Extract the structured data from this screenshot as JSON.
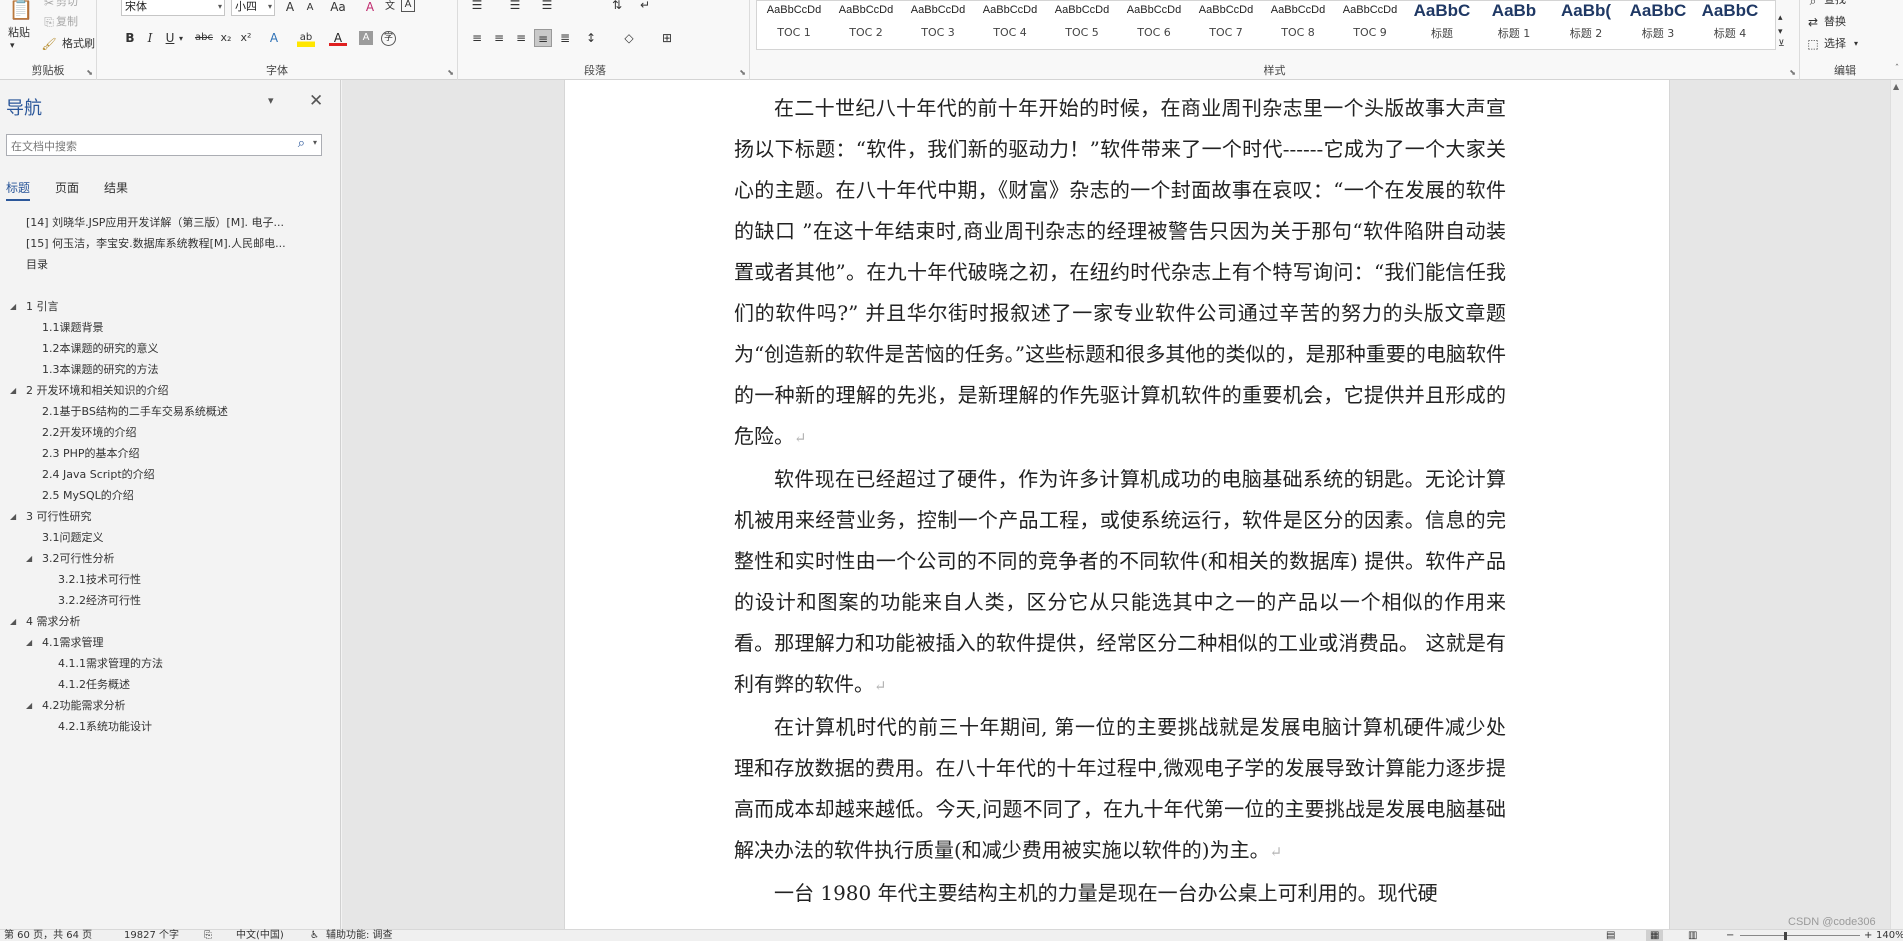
{
  "ribbon": {
    "clipboard": {
      "group_label": "剪贴板",
      "paste_label": "粘贴",
      "cut_label": "剪切",
      "copy_label": "复制",
      "format_painter_label": "格式刷"
    },
    "font": {
      "group_label": "字体",
      "font_name": "宋体",
      "font_size": "小四",
      "grow_icon": "A",
      "shrink_icon": "A",
      "change_case_icon": "Aa",
      "clear_format_icon": "A",
      "phonetic_icon": "文",
      "char_border_icon": "A",
      "bold": "B",
      "italic": "I",
      "underline": "U",
      "strike": "abc",
      "subscript": "x₂",
      "superscript": "x²",
      "text_effect": "A",
      "highlight": "ab",
      "font_color": "A",
      "char_shading": "A",
      "enclose": "字"
    },
    "paragraph": {
      "group_label": "段落"
    },
    "styles": {
      "group_label": "样式",
      "items": [
        {
          "preview": "AaBbCcDd",
          "name": "TOC 1"
        },
        {
          "preview": "AaBbCcDd",
          "name": "TOC 2"
        },
        {
          "preview": "AaBbCcDd",
          "name": "TOC 3"
        },
        {
          "preview": "AaBbCcDd",
          "name": "TOC 4"
        },
        {
          "preview": "AaBbCcDd",
          "name": "TOC 5"
        },
        {
          "preview": "AaBbCcDd",
          "name": "TOC 6"
        },
        {
          "preview": "AaBbCcDd",
          "name": "TOC 7"
        },
        {
          "preview": "AaBbCcDd",
          "name": "TOC 8"
        },
        {
          "preview": "AaBbCcDd",
          "name": "TOC 9"
        },
        {
          "preview": "AaBbC",
          "name": "标题"
        },
        {
          "preview": "AaBb",
          "name": "标题 1"
        },
        {
          "preview": "AaBb(",
          "name": "标题 2"
        },
        {
          "preview": "AaBbC",
          "name": "标题 3"
        },
        {
          "preview": "AaBbC",
          "name": "标题 4"
        }
      ]
    },
    "editing": {
      "group_label": "编辑",
      "find_label": "查找",
      "replace_label": "替换",
      "select_label": "选择"
    }
  },
  "nav": {
    "title": "导航",
    "search_placeholder": "在文档中搜索",
    "tabs": [
      "标题",
      "页面",
      "结果"
    ],
    "tree": [
      {
        "label": "[14] 刘晓华.JSP应用开发详解（第三版）[M]. 电子...",
        "level": 1,
        "arrow": ""
      },
      {
        "label": "[15] 何玉洁，李宝安.数据库系统教程[M].人民邮电...",
        "level": 1,
        "arrow": ""
      },
      {
        "label": "目录",
        "level": 1,
        "arrow": ""
      },
      {
        "label": "",
        "level": 0,
        "arrow": ""
      },
      {
        "label": "1 引言",
        "level": 1,
        "arrow": "◢"
      },
      {
        "label": "1.1课题背景",
        "level": 2,
        "arrow": ""
      },
      {
        "label": "1.2本课题的研究的意义",
        "level": 2,
        "arrow": ""
      },
      {
        "label": "1.3本课题的研究的方法",
        "level": 2,
        "arrow": ""
      },
      {
        "label": "2 开发环境和相关知识的介绍",
        "level": 1,
        "arrow": "◢"
      },
      {
        "label": "2.1基于BS结构的二手车交易系统概述",
        "level": 2,
        "arrow": ""
      },
      {
        "label": "2.2开发环境的介绍",
        "level": 2,
        "arrow": ""
      },
      {
        "label": "2.3 PHP的基本介绍",
        "level": 2,
        "arrow": ""
      },
      {
        "label": "2.4 Java Script的介绍",
        "level": 2,
        "arrow": ""
      },
      {
        "label": "2.5 MySQL的介绍",
        "level": 2,
        "arrow": ""
      },
      {
        "label": "3 可行性研究",
        "level": 1,
        "arrow": "◢"
      },
      {
        "label": "3.1问题定义",
        "level": 2,
        "arrow": ""
      },
      {
        "label": "3.2可行性分析",
        "level": 2,
        "arrow": "◢"
      },
      {
        "label": "3.2.1技术可行性",
        "level": 3,
        "arrow": ""
      },
      {
        "label": "3.2.2经济可行性",
        "level": 3,
        "arrow": ""
      },
      {
        "label": "4 需求分析",
        "level": 1,
        "arrow": "◢"
      },
      {
        "label": "4.1需求管理",
        "level": 2,
        "arrow": "◢"
      },
      {
        "label": "4.1.1需求管理的方法",
        "level": 3,
        "arrow": ""
      },
      {
        "label": "4.1.2任务概述",
        "level": 3,
        "arrow": ""
      },
      {
        "label": "4.2功能需求分析",
        "level": 2,
        "arrow": "◢"
      },
      {
        "label": "4.2.1系统功能设计",
        "level": 3,
        "arrow": ""
      }
    ]
  },
  "document": {
    "paragraphs": [
      "在二十世纪八十年代的前十年开始的时候，在商业周刊杂志里一个头版故事大声宣扬以下标题：“软件，我们新的驱动力！”软件带来了一个时代------它成为了一个大家关心的主题。在八十年代中期，《财富》杂志的一个封面故事在哀叹：“一个在发展的软件的缺口 ”在这十年结束时,商业周刊杂志的经理被警告只因为关于那句“软件陷阱自动装置或者其他”。在九十年代破晓之初，在纽约时代杂志上有个特写询问：“我们能信任我们的软件吗?”  并且华尔街时报叙述了一家专业软件公司通过辛苦的努力的头版文章题为“创造新的软件是苦恼的任务。”这些标题和很多其他的类似的，是那种重要的电脑软件的一种新的理解的先兆，是新理解的作先驱计算机软件的重要机会，它提供并且形成的危险。",
      "软件现在已经超过了硬件，作为许多计算机成功的电脑基础系统的钥匙。无论计算机被用来经营业务，控制一个产品工程，或使系统运行，软件是区分的因素。信息的完整性和实时性由一个公司的不同的竞争者的不同软件(和相关的数据库) 提供。软件产品的设计和图案的功能来自人类，区分它从只能选其中之一的产品以一个相似的作用来看。那理解力和功能被插入的软件提供，经常区分二种相似的工业或消费品。  这就是有利有弊的软件。",
      "在计算机时代的前三十年期间, 第一位的主要挑战就是发展电脑计算机硬件减少处理和存放数据的费用。在八十年代的十年过程中,微观电子学的发展导致计算能力逐步提高而成本却越来越低。今天,问题不同了，在九十年代第一位的主要挑战是发展电脑基础解决办法的软件执行质量(和减少费用被实施以软件的)为主。",
      "一台 1980 年代主要结构主机的力量是现在一台办公桌上可利用的。现代硬"
    ],
    "paragraph_mark": "↵"
  },
  "status": {
    "page": "第 60 页，共 64 页",
    "words": "19827 个字",
    "language": "中文(中国)",
    "accessibility": "辅助功能: 调查",
    "zoom": "140%"
  },
  "watermark": "CSDN @code306"
}
